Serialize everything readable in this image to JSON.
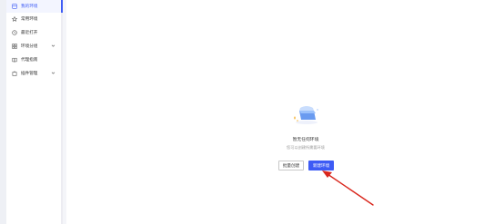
{
  "sidebar": {
    "items": [
      {
        "label": "我的环境",
        "icon": "environment-icon",
        "active": true,
        "has_chevron": false
      },
      {
        "label": "常用环境",
        "icon": "star-icon",
        "active": false,
        "has_chevron": false
      },
      {
        "label": "最近打开",
        "icon": "clock-icon",
        "active": false,
        "has_chevron": false
      },
      {
        "label": "环境分组",
        "icon": "grid-icon",
        "active": false,
        "has_chevron": true
      },
      {
        "label": "代理指南",
        "icon": "book-icon",
        "active": false,
        "has_chevron": false
      },
      {
        "label": "插件管理",
        "icon": "plugin-icon",
        "active": false,
        "has_chevron": true
      }
    ]
  },
  "empty_state": {
    "title": "暂无任何环境",
    "description": "您可以创建所需要环境",
    "batch_create_label": "批量创建",
    "new_env_label": "新建环境"
  },
  "colors": {
    "accent": "#3d5bf5",
    "arrow": "#d9261c"
  }
}
